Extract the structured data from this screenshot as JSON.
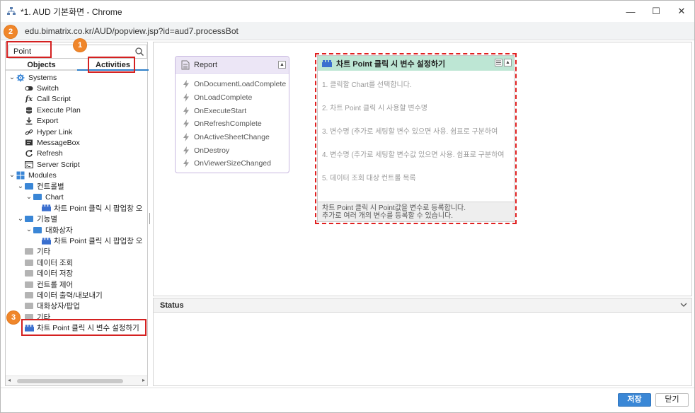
{
  "window": {
    "title": "*1. AUD 기본화면 - Chrome",
    "controls": {
      "minimize": "—",
      "maximize": "☐",
      "close": "✕"
    }
  },
  "address": {
    "url": "edu.bimatrix.co.kr/AUD/popview.jsp?id=aud7.processBot"
  },
  "search": {
    "value": "Point",
    "placeholder": ""
  },
  "tabs": [
    {
      "label": "Objects",
      "active": false
    },
    {
      "label": "Activities",
      "active": true
    }
  ],
  "tree": [
    {
      "label": "Systems",
      "level": 0,
      "expand": "v",
      "icon": "gear-icon"
    },
    {
      "label": "Switch",
      "level": 1,
      "expand": "",
      "icon": "toggle-icon"
    },
    {
      "label": "Call Script",
      "level": 1,
      "expand": "",
      "icon": "function-icon"
    },
    {
      "label": "Execute Plan",
      "level": 1,
      "expand": "",
      "icon": "database-icon"
    },
    {
      "label": "Export",
      "level": 1,
      "expand": "",
      "icon": "download-icon"
    },
    {
      "label": "Hyper Link",
      "level": 1,
      "expand": "",
      "icon": "link-icon"
    },
    {
      "label": "MessageBox",
      "level": 1,
      "expand": "",
      "icon": "message-icon"
    },
    {
      "label": "Refresh",
      "level": 1,
      "expand": "",
      "icon": "refresh-icon"
    },
    {
      "label": "Server Script",
      "level": 1,
      "expand": "",
      "icon": "terminal-icon"
    },
    {
      "label": "Modules",
      "level": 0,
      "expand": "v",
      "icon": "grid-icon"
    },
    {
      "label": "컨트롤별",
      "level": 1,
      "expand": "v",
      "icon": "folder-blue-icon"
    },
    {
      "label": "Chart",
      "level": 2,
      "expand": "v",
      "icon": "folder-blue-icon"
    },
    {
      "label": "차트 Point 클릭 시 팝업창 오",
      "level": 3,
      "expand": "",
      "icon": "module-icon"
    },
    {
      "label": "기능별",
      "level": 1,
      "expand": "v",
      "icon": "folder-blue-icon"
    },
    {
      "label": "대화상자",
      "level": 2,
      "expand": "v",
      "icon": "folder-blue-icon"
    },
    {
      "label": "차트 Point 클릭 시 팝업창 오",
      "level": 3,
      "expand": "",
      "icon": "module-icon"
    },
    {
      "label": "기타",
      "level": 1,
      "expand": "",
      "icon": "folder-gray-icon"
    },
    {
      "label": "데이터 조회",
      "level": 1,
      "expand": "",
      "icon": "folder-gray-icon"
    },
    {
      "label": "데이터 저장",
      "level": 1,
      "expand": "",
      "icon": "folder-gray-icon"
    },
    {
      "label": "컨트롤 제어",
      "level": 1,
      "expand": "",
      "icon": "folder-gray-icon"
    },
    {
      "label": "데이터 출력/내보내기",
      "level": 1,
      "expand": "",
      "icon": "folder-gray-icon"
    },
    {
      "label": "대화상자/팝업",
      "level": 1,
      "expand": "",
      "icon": "folder-gray-icon"
    },
    {
      "label": "기타",
      "level": 1,
      "expand": "",
      "icon": "folder-gray-icon"
    },
    {
      "label": "차트 Point 클릭 시 변수 설정하기",
      "level": 1,
      "expand": "",
      "icon": "module-icon"
    }
  ],
  "report_node": {
    "title": "Report",
    "events": [
      "OnDocumentLoadComplete",
      "OnLoadComplete",
      "OnExecuteStart",
      "OnRefreshComplete",
      "OnActiveSheetChange",
      "OnDestroy",
      "OnViewerSizeChanged"
    ]
  },
  "activity_node": {
    "title": "차트 Point 클릭 시 변수 설정하기",
    "params": [
      "1. 클릭할 Chart를 선택합니다.",
      "2. 차트 Point 클릭 시 사용할 변수명",
      "3. 변수명 (추가로 세팅할 변수 있으면 사용. 쉼표로 구분하여",
      "4. 변수명 (추가로 세팅할 변수값 있으면 사용. 쉼표로 구분하여",
      "5. 데이터 조회 대상 컨트롤 목록"
    ],
    "description_line1": "차트 Point 클릭 시 Point값을 변수로 등록합니다.",
    "description_line2": "추가로  여러 개의 변수를 등록할 수 있습니다."
  },
  "status": {
    "label": "Status"
  },
  "footer": {
    "save_label": "저장",
    "close_label": "닫기"
  },
  "callouts": {
    "one": "1",
    "two": "2",
    "three": "3"
  },
  "colors": {
    "accent": "#3a87d6",
    "highlight": "#d42020",
    "badge": "#f0862a",
    "report_header": "#ece6f6",
    "activity_header": "#bde6d4"
  }
}
